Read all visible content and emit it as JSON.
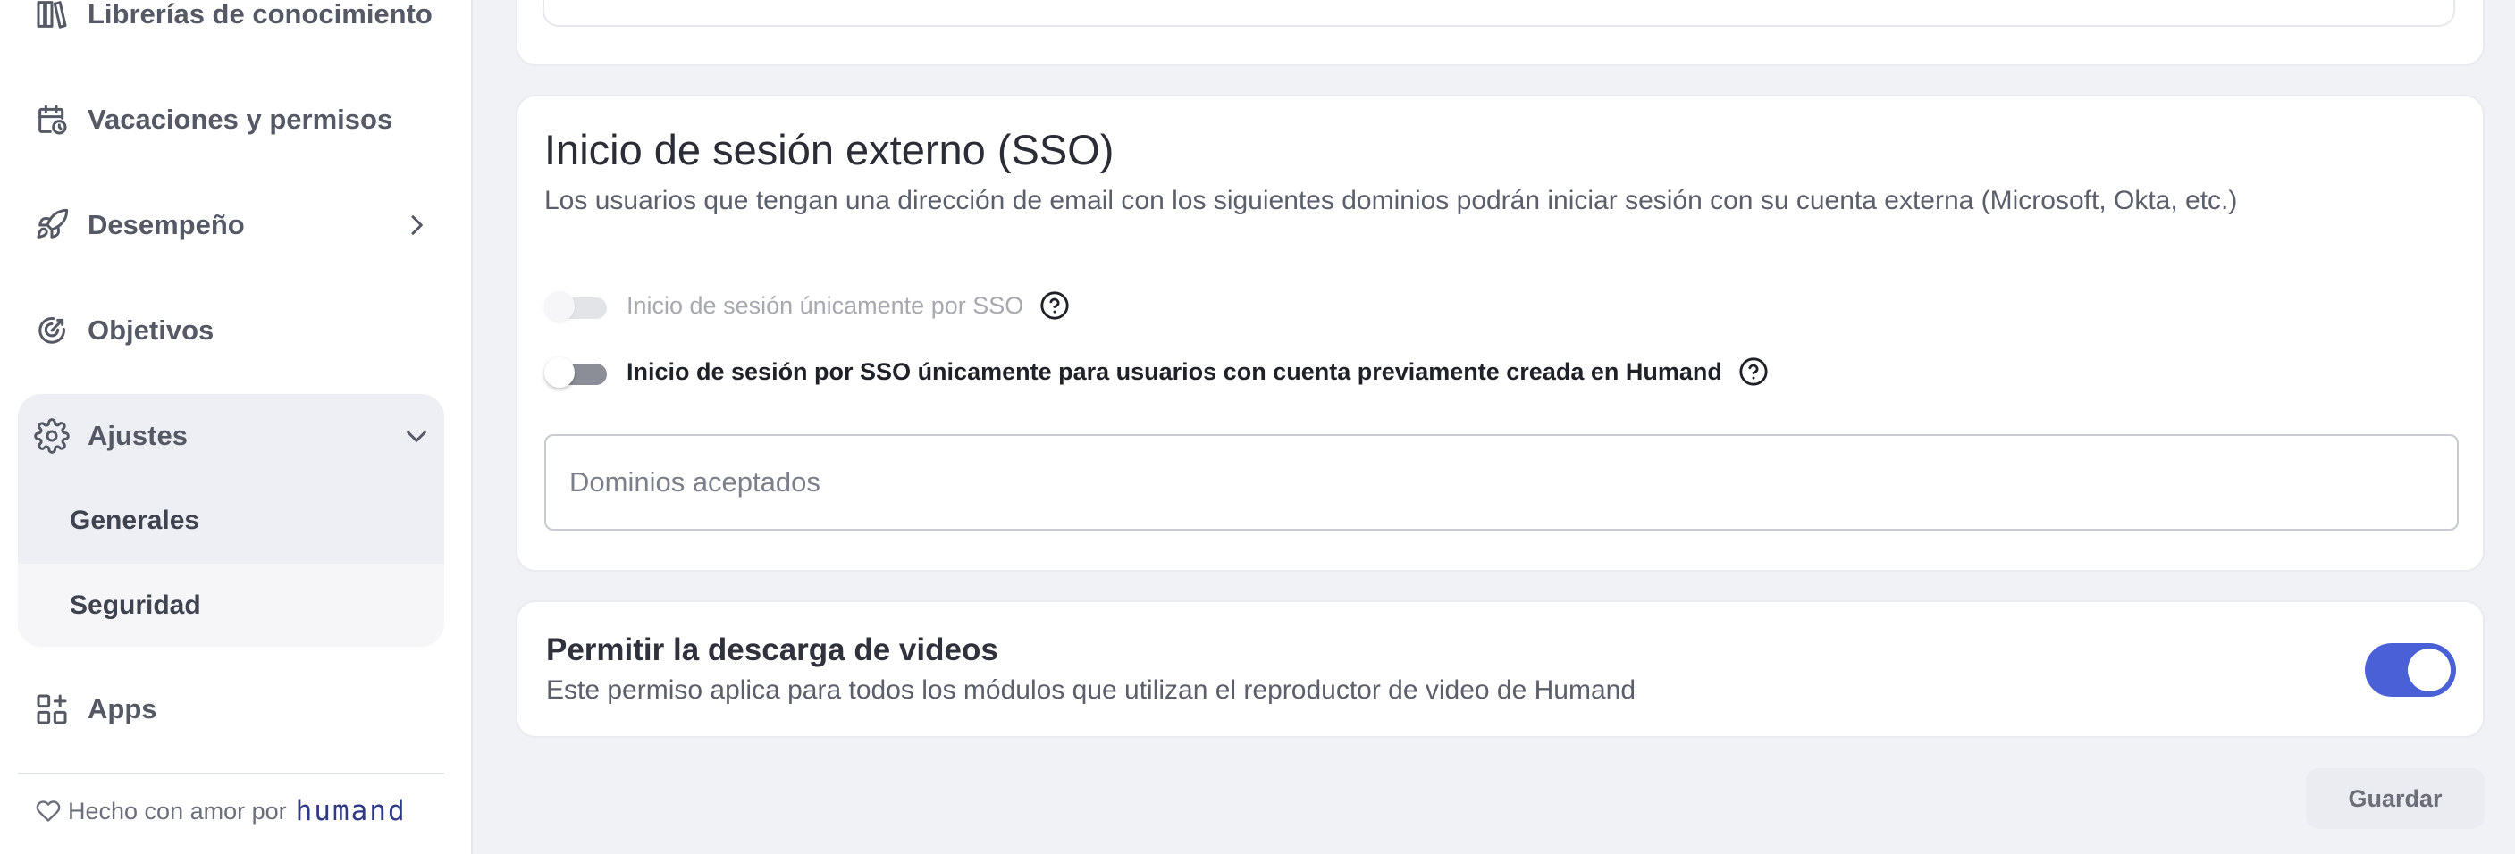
{
  "sidebar": {
    "items": [
      {
        "label": "Librerías de conocimiento",
        "icon": "books-icon"
      },
      {
        "label": "Vacaciones y permisos",
        "icon": "calendar-clock-icon"
      },
      {
        "label": "Desempeño",
        "icon": "rocket-icon"
      },
      {
        "label": "Objetivos",
        "icon": "target-icon"
      },
      {
        "label": "Ajustes",
        "icon": "gear-icon"
      },
      {
        "label": "Apps",
        "icon": "apps-grid-icon"
      }
    ],
    "ajustes_sub": [
      {
        "label": "Generales"
      },
      {
        "label": "Seguridad"
      }
    ],
    "footer": {
      "text": "Hecho con amor por",
      "brand": "humand",
      "icon": "heart-icon"
    }
  },
  "sso": {
    "title": "Inicio de sesión externo (SSO)",
    "description": "Los usuarios que tengan una dirección de email con los siguientes dominios podrán iniciar sesión con su cuenta externa (Microsoft, Okta, etc.)",
    "toggle_sso_only": {
      "label": "Inicio de sesión únicamente por SSO",
      "state": "disabled-off"
    },
    "toggle_existing_users": {
      "label": "Inicio de sesión por SSO únicamente para usuarios con cuenta previamente creada en Humand",
      "state": "off"
    },
    "domains_placeholder": "Dominios aceptados",
    "domains_value": ""
  },
  "video": {
    "title": "Permitir la descarga de videos",
    "description": "Este permiso aplica para todos los módulos que utilizan el reproductor de video de Humand",
    "toggle_state": "on"
  },
  "actions": {
    "save_label": "Guardar"
  },
  "colors": {
    "accent": "#4a60d6",
    "brand": "#2f3a86"
  }
}
